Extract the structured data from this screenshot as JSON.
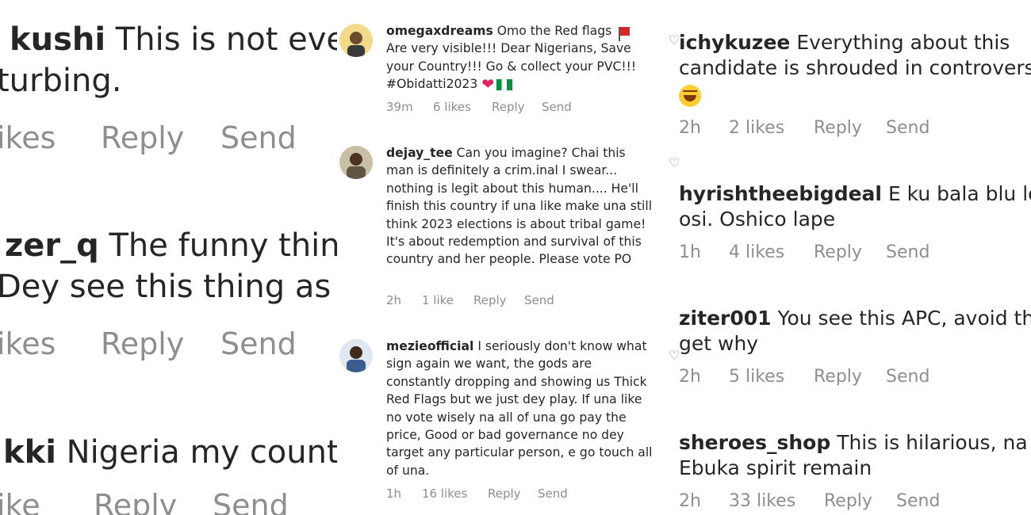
{
  "left_panel": {
    "comments": [
      {
        "user": "kushi",
        "line1": "This is not even",
        "line2": "turbing.",
        "likes": "ikes",
        "reply": "Reply",
        "send": "Send"
      },
      {
        "user": "zer_q",
        "line1": "The funny thing",
        "line2": "Dey see this thing as",
        "likes": "ikes",
        "reply": "Reply",
        "send": "Send"
      },
      {
        "user": "kki",
        "line1": "Nigeria my country",
        "likes": "ike",
        "reply": "Reply",
        "send": "Send"
      }
    ]
  },
  "middle_panel": {
    "comments": [
      {
        "user": "omegaxdreams",
        "text_pre": "Omo the Red flags",
        "text_post": "Are very visible!!! Dear Nigerians, Save your Country!!! Go & collect your PVC!!! #Obidatti2023",
        "time": "39m",
        "likes": "6 likes",
        "reply": "Reply",
        "send": "Send",
        "avatar_color": "#e8c36a"
      },
      {
        "user": "dejay_tee",
        "text": "Can you imagine? Chai this man is definitely a crim.inal I swear... nothing is legit about this human.... He'll finish this country if una like make una still think 2023 elections is about tribal game! It's about redemption and survival of this country and her people. Please vote PO",
        "time": "2h",
        "likes": "1 like",
        "reply": "Reply",
        "send": "Send",
        "avatar_color": "#7a6a4f"
      },
      {
        "user": "mezieofficial",
        "text": "I seriously don't know what sign again we want, the gods are constantly dropping and showing us Thick Red Flags but we just dey play. If una like no vote wisely na all of una go pay the price, Good or bad governance no dey target any particular person, e go touch all of una.",
        "time": "1h",
        "likes": "16 likes",
        "reply": "Reply",
        "send": "Send",
        "avatar_color": "#4a6fa5"
      }
    ]
  },
  "right_panel": {
    "comments": [
      {
        "user": "ichykuzee",
        "line1": "Everything about this",
        "line2": "candidate is shrouded in controversy",
        "time": "2h",
        "likes": "2 likes",
        "reply": "Reply",
        "send": "Send"
      },
      {
        "user": "hyrishtheebigdeal",
        "line1": "E ku bala blu loturu",
        "line2": "osi. Oshico lape",
        "time": "1h",
        "likes": "4 likes",
        "reply": "Reply",
        "send": "Send"
      },
      {
        "user": "ziter001",
        "line1": "You see this APC,  avoid the",
        "line2": "get why",
        "time": "2h",
        "likes": "5 likes",
        "reply": "Reply",
        "send": "Send"
      },
      {
        "user": "sheroes_shop",
        "line1": "This is hilarious, na",
        "line2": "Ebuka spirit remain",
        "time": "2h",
        "likes": "33 likes",
        "reply": "Reply",
        "send": "Send"
      }
    ]
  },
  "icons": {
    "like": "heart-outline-icon",
    "emoji_red_heart": "red-heart-emoji",
    "emoji_flag": "nigeria-flag-emoji",
    "emoji_red_flag": "red-flag-emoji",
    "emoji_laugh": "tears-of-joy-emoji"
  }
}
